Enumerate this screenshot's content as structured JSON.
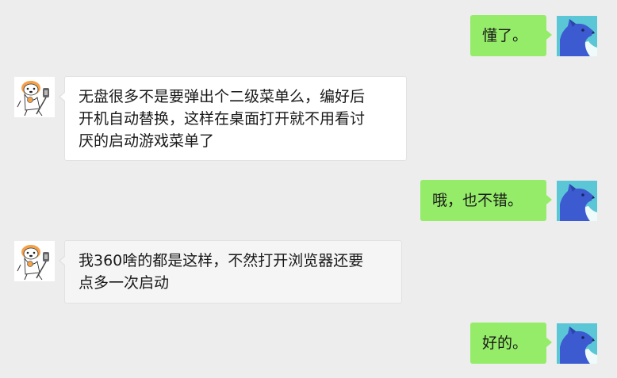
{
  "colors": {
    "background": "#ededed",
    "self_bubble": "#95ec69",
    "other_bubble": "#ffffff",
    "other_bubble_alt": "#f5f5f5",
    "text": "#191919",
    "self_avatar_bg": "#5bc6d6",
    "self_avatar_fg": "#3d5bd0"
  },
  "avatars": {
    "self": "blue-wolf-avatar-icon",
    "other": "cartoon-dog-avatar-icon"
  },
  "messages": [
    {
      "sender": "self",
      "text": "懂了。"
    },
    {
      "sender": "other",
      "text": "无盘很多不是要弹出个二级菜单么，编好后\n开机自动替换，这样在桌面打开就不用看讨\n厌的启动游戏菜单了"
    },
    {
      "sender": "self",
      "text": "哦，也不错。"
    },
    {
      "sender": "other",
      "text": "我360啥的都是这样，不然打开浏览器还要\n点多一次启动"
    },
    {
      "sender": "self",
      "text": "好的。"
    }
  ]
}
